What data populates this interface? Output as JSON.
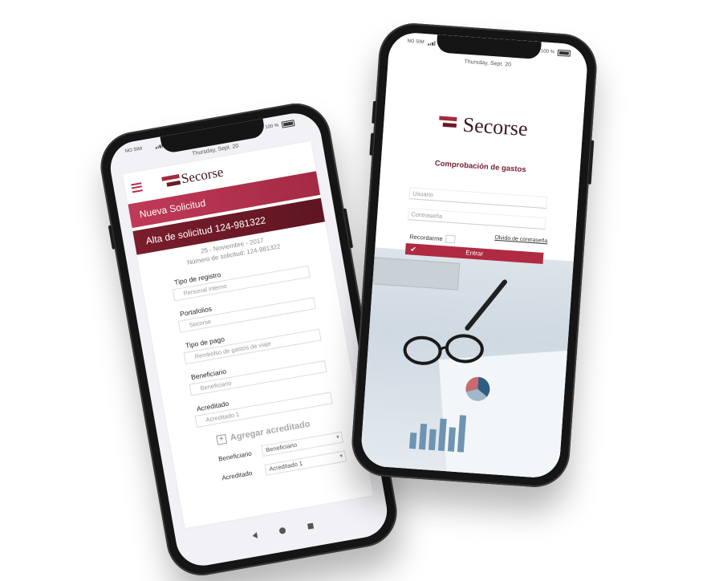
{
  "left_phone": {
    "status": {
      "carrier": "NO SIM",
      "battery": "100 %"
    },
    "date": "Thursday, Sept. 20",
    "brand": "Secorse",
    "banner_primary": "Nueva Solicitud",
    "banner_secondary": "Alta de solicitud 124-981322",
    "request_date": "25 - Noviembre - 2017",
    "request_number": "Número de solicitud: 124-981322",
    "fields": [
      {
        "label": "Tipo de registro",
        "value": "Personal interno"
      },
      {
        "label": "Portafolios",
        "value": "Secorse"
      },
      {
        "label": "Tipo de pago",
        "value": "Rembolso de gastos de viaje"
      },
      {
        "label": "Beneficiario",
        "value": "Beneficiario"
      },
      {
        "label": "Acreditado",
        "value": "Acreditado 1"
      }
    ],
    "add_label": "Agregar acreditado",
    "selects": [
      {
        "label": "Beneficiario",
        "value": "Beneficiario"
      },
      {
        "label": "Acreditado",
        "value": "Acreditado 1"
      }
    ]
  },
  "right_phone": {
    "status": {
      "carrier": "NO SIM",
      "battery": "100 %"
    },
    "date": "Thursday, Sept. 20",
    "brand": "Secorse",
    "title": "Comprobación de gastos",
    "username_placeholder": "Usuario",
    "password_placeholder": "Contraseña",
    "remember_label": "Recordarme",
    "forgot_label": "Olvido de contraseña",
    "enter_label": "Entrar"
  },
  "colors": {
    "brand": "#a42a3e",
    "brand_dark": "#5e1622",
    "accent": "#b02a42"
  },
  "icons": [
    "menu-icon",
    "plus-icon",
    "chevron-down-icon",
    "check-icon",
    "back-icon",
    "home-icon",
    "recent-apps-icon",
    "battery-icon",
    "signal-icon"
  ]
}
